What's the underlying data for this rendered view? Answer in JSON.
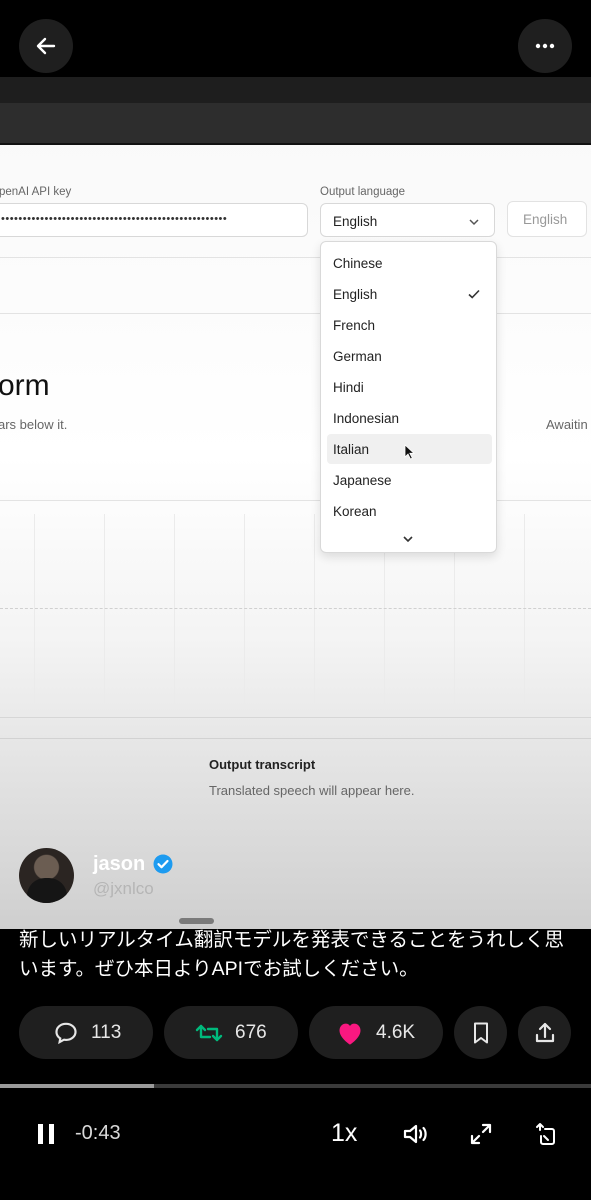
{
  "top": {
    "back_icon": "arrow-left-icon",
    "more_icon": "more-horizontal-icon"
  },
  "video": {
    "api_key_label": "penAI API key",
    "api_key_value": "••••••••••••••••••••••••••••••••••••••••••••••••••••",
    "output_language_label": "Output language",
    "selected_language": "English",
    "language_button": "English",
    "heading_fragment": "orm",
    "subtext_fragment": "ars below it.",
    "status_fragment": "Awaitin",
    "language_options": [
      "Chinese",
      "English",
      "French",
      "German",
      "Hindi",
      "Indonesian",
      "Italian",
      "Japanese",
      "Korean"
    ],
    "checked_option": "English",
    "hovered_option": "Italian",
    "transcript_title": "Output transcript",
    "transcript_placeholder": "Translated speech will appear here."
  },
  "author": {
    "name": "jason",
    "handle": "@jxnlco",
    "verified": true,
    "verified_color": "#1d9bf0"
  },
  "caption": "新しいリアルタイム翻訳モデルを発表できることをうれしく思います。ぜひ本日よりAPIでお試しください。",
  "actions": {
    "replies": "113",
    "reposts": "676",
    "likes": "4.6K",
    "repost_color": "#00ba7c",
    "like_color": "#f91880"
  },
  "player": {
    "progress": 0.26,
    "time_remaining": "-0:43",
    "speed": "1x"
  }
}
